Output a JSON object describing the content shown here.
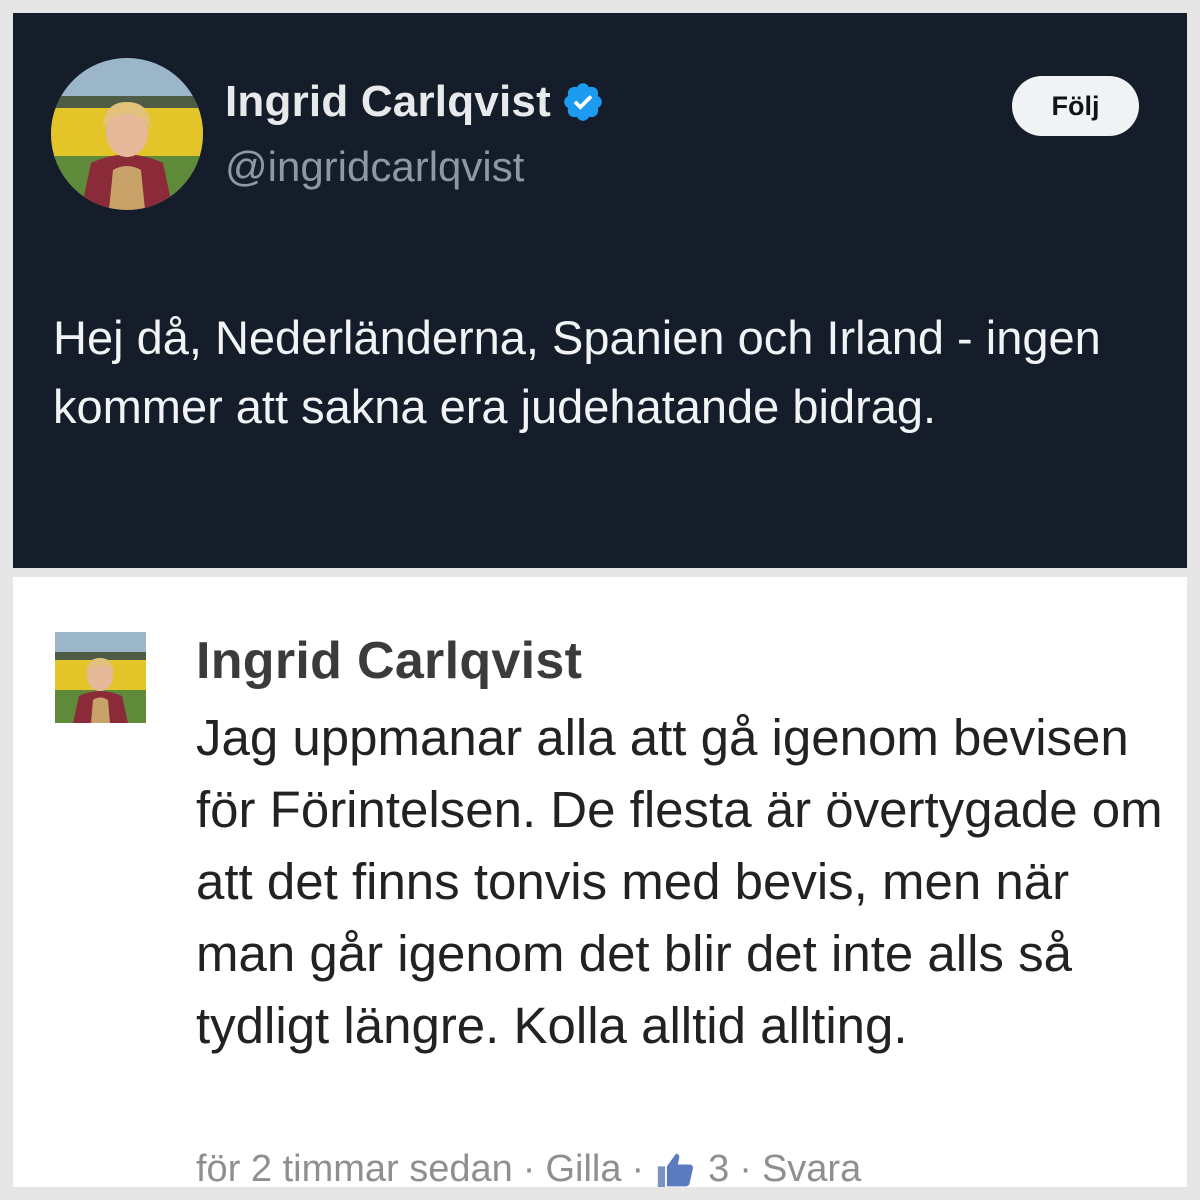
{
  "tweet": {
    "author_name": "Ingrid Carlqvist",
    "handle": "@ingridcarlqvist",
    "follow_label": "Följ",
    "text": "Hej då, Nederländerna, Spanien och Irland - ingen kommer att sakna era judehatande bidrag.",
    "verified_color": "#1d9bf0",
    "avatar_icon": "profile-photo"
  },
  "comment": {
    "author_name": "Ingrid Carlqvist",
    "text": "Jag uppmanar alla att gå igenom bevisen för Förintelsen. De flesta är övertygade om att det finns tonvis med bevis, men när man går igenom det blir det inte alls så tydligt längre. Kolla alltid allting.",
    "meta": {
      "time": "för 2 timmar sedan",
      "sep": "·",
      "like_label": "Gilla",
      "like_count": "3",
      "reply_label": "Svara"
    }
  }
}
